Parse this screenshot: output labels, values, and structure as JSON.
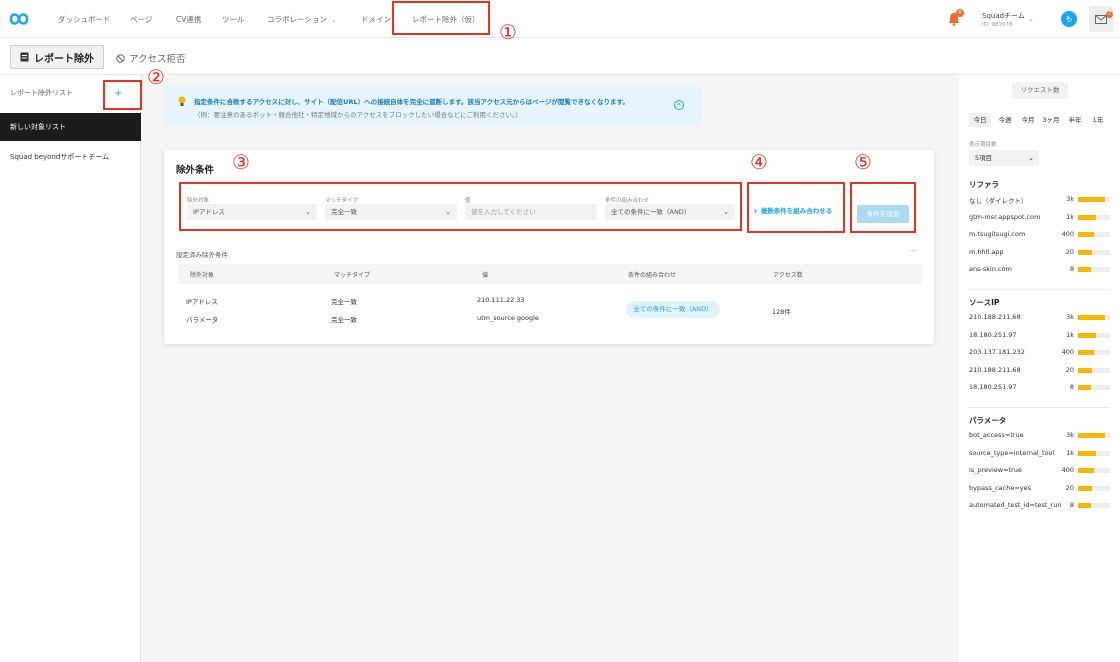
{
  "nav": {
    "items": [
      "ダッシュボード",
      "ページ",
      "CV連携",
      "ツール",
      "コラボレーション",
      "ドメイン",
      "レポート除外（仮）"
    ],
    "bell_badge": "9",
    "team_name": "Squadチーム",
    "team_id": "ID: 987678",
    "avatar_letter": "も",
    "mail_badge": "2"
  },
  "subheader": {
    "report_exclusion_label": "レポート除外",
    "access_deny_label": "アクセス拒否"
  },
  "left_sidebar": {
    "title": "レポート除外リスト",
    "add_label": "+",
    "items": [
      "新しい対象リスト",
      "Squad beyondサポートチーム"
    ]
  },
  "info_banner": {
    "main_text": "指定条件に合致するアクセスに対し、サイト（配信URL）への接続自体を完全に遮断します。該当アクセス元からはページが閲覧できなくなります。",
    "sub_text": "（例：要注意のあるボット・競合他社・特定地域からのアクセスをブロックしたい場合などにご利用ください。）",
    "close": "×"
  },
  "conditions": {
    "title": "除外条件",
    "target_label": "除外対象",
    "target_value": "IPアドレス",
    "match_label": "マッチタイプ",
    "match_value": "完全一致",
    "value_label": "値",
    "value_placeholder": "値を入力してください",
    "combine_label": "条件の組み合わせ",
    "combine_value": "全ての条件に一致（AND）",
    "combine_button": "+ 複数条件を組み合わせる",
    "add_button": "条件を追加"
  },
  "configured": {
    "title": "設定済み除外条件",
    "more": "···",
    "headers": [
      "除外対象",
      "マッチタイプ",
      "値",
      "条件の組み合わせ",
      "アクセス数"
    ],
    "rows": [
      {
        "target": "IPアドレス",
        "match": "完全一致",
        "value": "210.111.22.33"
      },
      {
        "target": "パラメータ",
        "match": "完全一致",
        "value": "utm_source google"
      }
    ],
    "combine": "全ての条件に一致（AND）",
    "access_count": "128件"
  },
  "right_sidebar": {
    "request_button": "リクエスト数",
    "period_tabs": [
      "今日",
      "今週",
      "今月",
      "3ヶ月",
      "半年",
      "1年"
    ],
    "active_tab": "今日",
    "display_label": "表示項目数",
    "display_value": "5項目",
    "bar_color": "#f5b800",
    "groups": [
      {
        "title": "リファラ",
        "rows": [
          {
            "label": "なし（ダイレクト）",
            "value": "3k",
            "level": 0.85
          },
          {
            "label": "gtm-msr.appspot.com",
            "value": "1k",
            "level": 0.55
          },
          {
            "label": "m.tsugitsugi.com",
            "value": "400",
            "level": 0.5
          },
          {
            "label": "m.hhll.app",
            "value": "20",
            "level": 0.45
          },
          {
            "label": "ans-skin.com",
            "value": "8",
            "level": 0.4
          }
        ]
      },
      {
        "title": "ソースIP",
        "rows": [
          {
            "label": "210.188.211.68",
            "value": "3k",
            "level": 0.85
          },
          {
            "label": "18.180.251.97",
            "value": "1k",
            "level": 0.55
          },
          {
            "label": "203.137.181.232",
            "value": "400",
            "level": 0.5
          },
          {
            "label": "210.188.211.68",
            "value": "20",
            "level": 0.45
          },
          {
            "label": "18.180.251.97",
            "value": "8",
            "level": 0.4
          }
        ]
      },
      {
        "title": "パラメータ",
        "rows": [
          {
            "label": "bot_access=true",
            "value": "3k",
            "level": 0.85
          },
          {
            "label": "source_type=internal_tool",
            "value": "1k",
            "level": 0.55
          },
          {
            "label": "is_preview=true",
            "value": "400",
            "level": 0.5
          },
          {
            "label": "bypass_cache=yes",
            "value": "20",
            "level": 0.45
          },
          {
            "label": "automated_test_id=test_run",
            "value": "8",
            "level": 0.4
          }
        ]
      }
    ]
  },
  "annotations": [
    "①",
    "②",
    "③",
    "④",
    "⑤"
  ]
}
